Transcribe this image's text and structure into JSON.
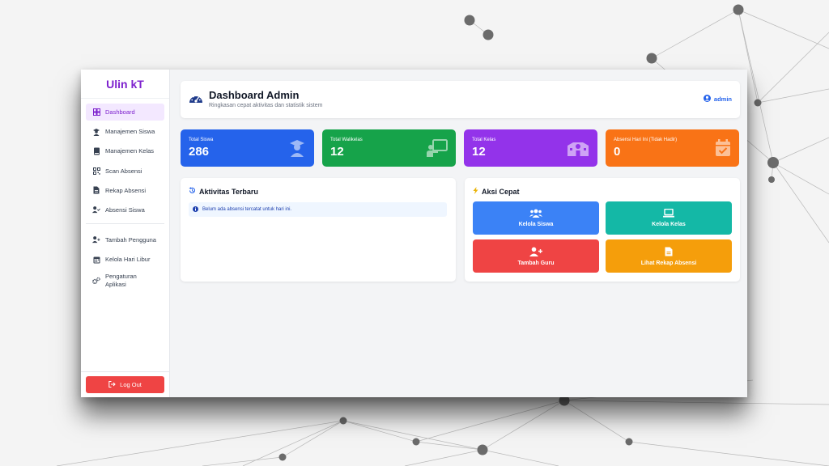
{
  "sidebar": {
    "brand": "Ulin kT",
    "items": [
      {
        "label": "Dashboard",
        "icon": "dashboard-icon",
        "active": true
      },
      {
        "label": "Manajemen Siswa",
        "icon": "student-icon"
      },
      {
        "label": "Manajemen Kelas",
        "icon": "book-icon"
      },
      {
        "label": "Scan Absensi",
        "icon": "qrcode-icon"
      },
      {
        "label": "Rekap Absensi",
        "icon": "file-icon"
      },
      {
        "label": "Absensi Siswa",
        "icon": "user-check-icon"
      }
    ],
    "items2": [
      {
        "label": "Tambah Pengguna",
        "icon": "user-plus-icon"
      },
      {
        "label": "Kelola Hari Libur",
        "icon": "calendar-icon"
      },
      {
        "label": "Pengaturan Aplikasi",
        "icon": "gears-icon"
      }
    ],
    "logout": "Log Out"
  },
  "header": {
    "title": "Dashboard Admin",
    "subtitle": "Ringkasan cepat aktivitas dan statistik sistem",
    "user": "admin"
  },
  "stats": [
    {
      "label": "Total Siswa",
      "value": "286",
      "color": "#2563eb",
      "icon": "graduate-icon"
    },
    {
      "label": "Total Walikelas",
      "value": "12",
      "color": "#16a34a",
      "icon": "teacher-board-icon"
    },
    {
      "label": "Total Kelas",
      "value": "12",
      "color": "#9333ea",
      "icon": "school-icon"
    },
    {
      "label": "Absensi Hari Ini (Tidak Hadir)",
      "value": "0",
      "color": "#f97316",
      "icon": "calendar-check-icon"
    }
  ],
  "activity": {
    "title": "Aktivitas Terbaru",
    "empty": "Belum ada absensi tercatat untuk hari ini."
  },
  "quick": {
    "title": "Aksi Cepat",
    "buttons": [
      {
        "label": "Kelola Siswa",
        "color": "#3b82f6",
        "icon": "users-icon"
      },
      {
        "label": "Kelola Kelas",
        "color": "#14b8a6",
        "icon": "laptop-icon"
      },
      {
        "label": "Tambah Guru",
        "color": "#ef4444",
        "icon": "user-plus-icon"
      },
      {
        "label": "Lihat Rekap Absensi",
        "color": "#f59e0b",
        "icon": "file-icon"
      }
    ]
  },
  "colors": {
    "brand": "#7e22ce",
    "accent": "#2563eb"
  }
}
